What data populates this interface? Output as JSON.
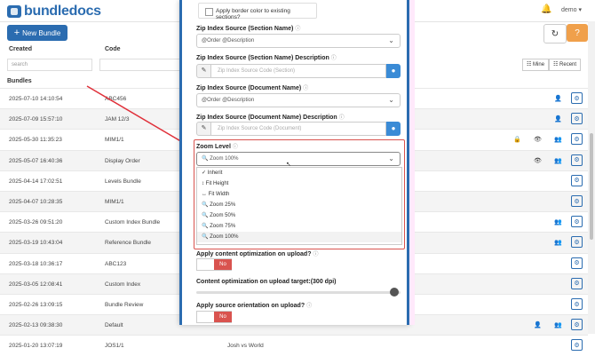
{
  "app": {
    "brand": "bundledocs",
    "user": "demo",
    "new_bundle_label": "New Bundle"
  },
  "table": {
    "headers": [
      "Created",
      "Code"
    ],
    "search_placeholder": "search",
    "filter_mine": "Mine",
    "filter_recent": "Recent",
    "section_label": "Bundles",
    "rows": [
      {
        "created": "2025-07-10 14:10:54",
        "code": "ABC456"
      },
      {
        "created": "2025-07-09 15:57:10",
        "code": "JAM 12/3"
      },
      {
        "created": "2025-05-30 11:35:23",
        "code": "MIM1/1"
      },
      {
        "created": "2025-05-07 16:40:36",
        "code": "Display Order"
      },
      {
        "created": "2025-04-14 17:02:51",
        "code": "Levels Bundle"
      },
      {
        "created": "2025-04-07 10:28:35",
        "code": "MIM1/1"
      },
      {
        "created": "2025-03-26 09:51:20",
        "code": "Custom Index Bundle"
      },
      {
        "created": "2025-03-19 10:43:04",
        "code": "Reference Bundle"
      },
      {
        "created": "2025-03-18 10:36:17",
        "code": "ABC123"
      },
      {
        "created": "2025-03-05 12:08:41",
        "code": "Custom Index"
      },
      {
        "created": "2025-02-26 13:09:15",
        "code": "Bundle Review"
      },
      {
        "created": "2025-02-13 09:38:30",
        "code": "Default"
      },
      {
        "created": "2025-01-20 13:07:19",
        "code": "JOS1/1"
      }
    ],
    "row_extra_text": "Josh vs World"
  },
  "modal": {
    "border_color_checkbox": "Apply border color to existing sections?",
    "zip_section_name_label": "Zip Index Source (Section Name)",
    "zip_section_name_value": "@Order @Description",
    "zip_section_desc_label": "Zip Index Source (Section Name) Description",
    "zip_section_desc_placeholder": "Zip Index Source Code (Section)",
    "zip_doc_name_label": "Zip Index Source (Document Name)",
    "zip_doc_name_value": "@Order @Description",
    "zip_doc_desc_label": "Zip Index Source (Document Name) Description",
    "zip_doc_desc_placeholder": "Zip Index Source Code (Document)",
    "zoom_label": "Zoom Level",
    "zoom_value": "Zoom 100%",
    "zoom_options": [
      "Inherit",
      "Fit Height",
      "Fit Width",
      "Zoom 25%",
      "Zoom 50%",
      "Zoom 75%",
      "Zoom 100%"
    ],
    "content_opt_label": "Apply content optimization on upload?",
    "content_opt_toggle": "No",
    "target_label": "Content optimization on upload target:(300 dpi)",
    "target_value": 1.0,
    "orientation_label": "Apply source orientation on upload?",
    "orientation_toggle": "No"
  },
  "colors": {
    "brand": "#2b6cb0",
    "danger": "#d9534f",
    "warning": "#f0a04b"
  }
}
